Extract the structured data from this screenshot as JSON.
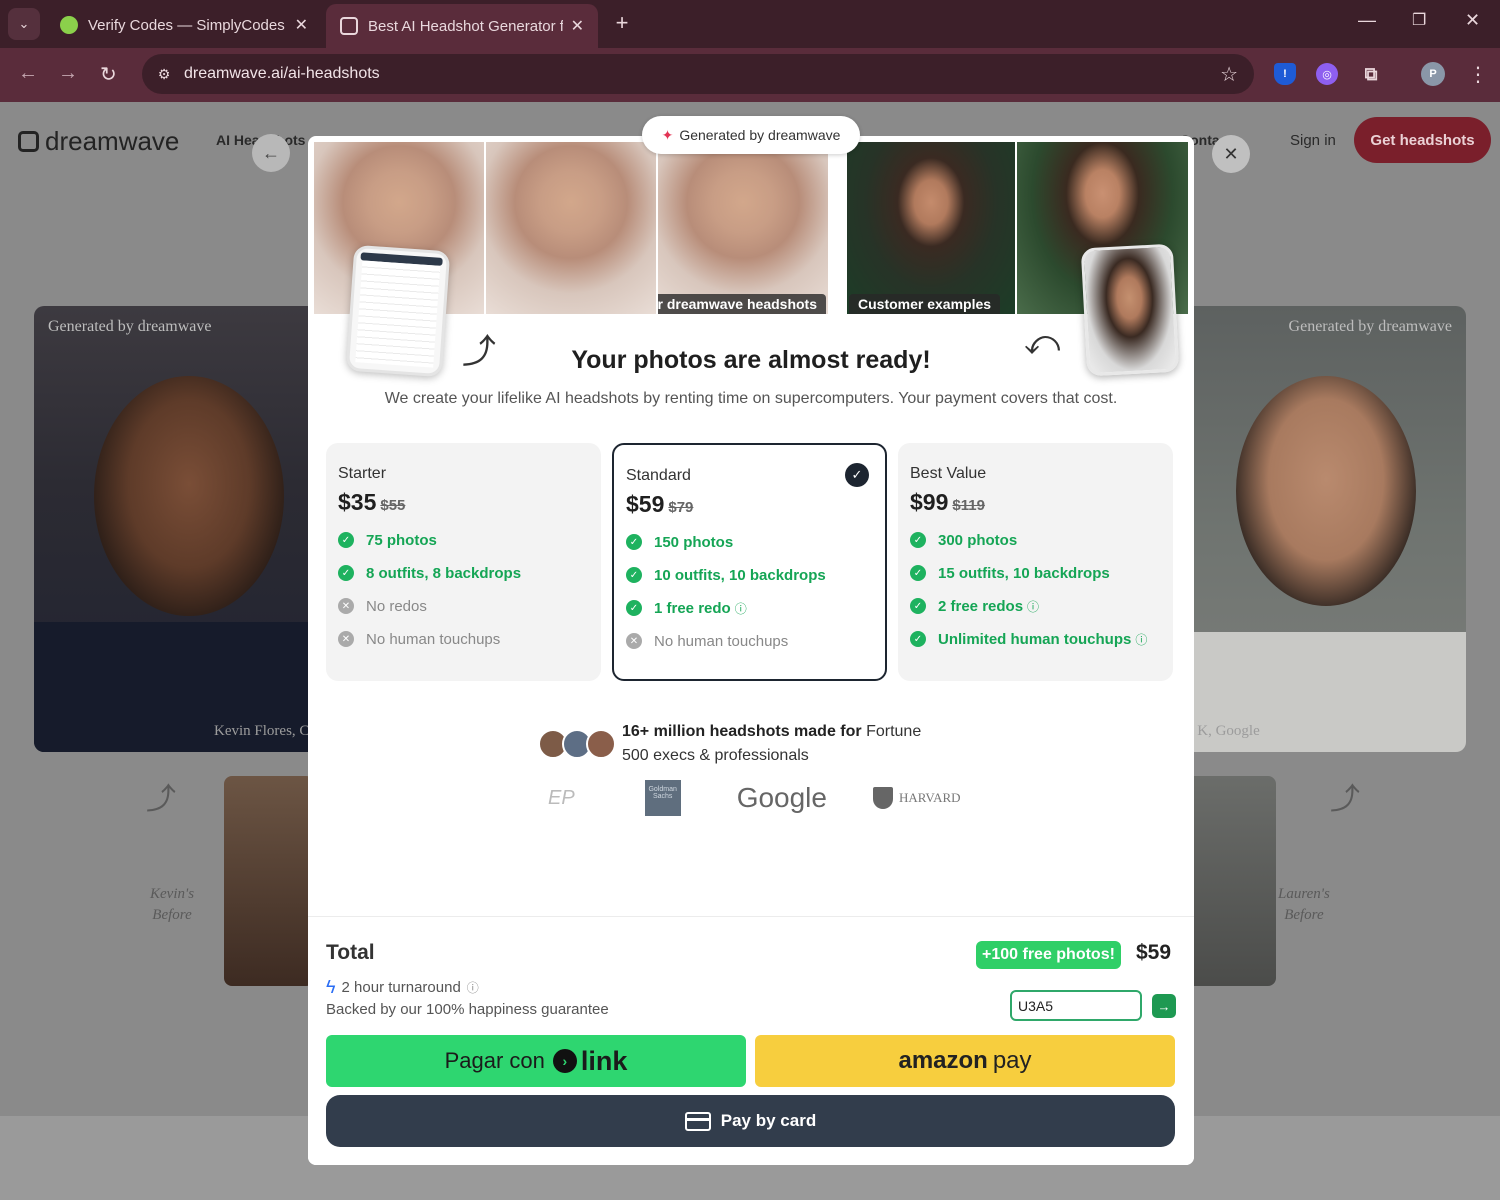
{
  "browser": {
    "tabs": [
      {
        "title": "Verify Codes — SimplyCodes",
        "icon": "simplycodes-icon",
        "active": false
      },
      {
        "title": "Best AI Headshot Generator for",
        "icon": "dreamwave-icon",
        "active": true
      }
    ],
    "url": "dreamwave.ai/ai-headshots",
    "profile_initial": "P"
  },
  "site": {
    "logo_text": "dreamwave",
    "nav": [
      "AI Headshots",
      "Contact"
    ],
    "sign_in": "Sign in",
    "cta": "Get headshots",
    "bg_left": {
      "tag": "Generated by dreamwave",
      "name": "Kevin Flores, C"
    },
    "bg_right": {
      "tag": "Generated by dreamwave",
      "name": "n K, Google"
    },
    "before_left": "Kevin's\nBefore",
    "before_right": "Lauren's\nBefore"
  },
  "modal": {
    "generated_pill": "Generated by dreamwave",
    "tile_left_label": "Your dreamwave headshots",
    "tile_right_label": "Customer examples",
    "title": "Your photos are almost ready!",
    "subtitle": "We create your lifelike AI headshots by renting time on supercomputers. Your payment covers that cost.",
    "plans": [
      {
        "name": "Starter",
        "price": "$35",
        "old_price": "$55",
        "selected": false,
        "features": [
          {
            "text": "75 photos",
            "on": true
          },
          {
            "text": "8 outfits, 8 backdrops",
            "on": true
          },
          {
            "text": "No redos",
            "on": false
          },
          {
            "text": "No human touchups",
            "on": false
          }
        ]
      },
      {
        "name": "Standard",
        "price": "$59",
        "old_price": "$79",
        "selected": true,
        "features": [
          {
            "text": "150 photos",
            "on": true
          },
          {
            "text": "10 outfits, 10 backdrops",
            "on": true
          },
          {
            "text": "1 free redo",
            "on": true,
            "info": true
          },
          {
            "text": "No human touchups",
            "on": false
          }
        ]
      },
      {
        "name": "Best Value",
        "price": "$99",
        "old_price": "$119",
        "selected": false,
        "features": [
          {
            "text": "300 photos",
            "on": true
          },
          {
            "text": "15 outfits, 10 backdrops",
            "on": true
          },
          {
            "text": "2 free redos",
            "on": true,
            "info": true
          },
          {
            "text": "Unlimited human touchups",
            "on": true,
            "info": true
          }
        ]
      }
    ],
    "proof_bold": "16+ million headshots made for",
    "proof_rest": " Fortune 500 execs & professionals",
    "logos": [
      "EP",
      "Goldman Sachs",
      "Google",
      "HARVARD"
    ],
    "total_label": "Total",
    "free_badge": "+100 free photos!",
    "total_value": "$59",
    "turnaround": "2 hour turnaround",
    "guarantee": "Backed by our 100% happiness guarantee",
    "promo_code": "U3A5",
    "link_prefix": "Pagar con",
    "link_brand": "link",
    "amazon_brand": "amazon",
    "amazon_pay": "pay",
    "card_label": "Pay by card"
  }
}
